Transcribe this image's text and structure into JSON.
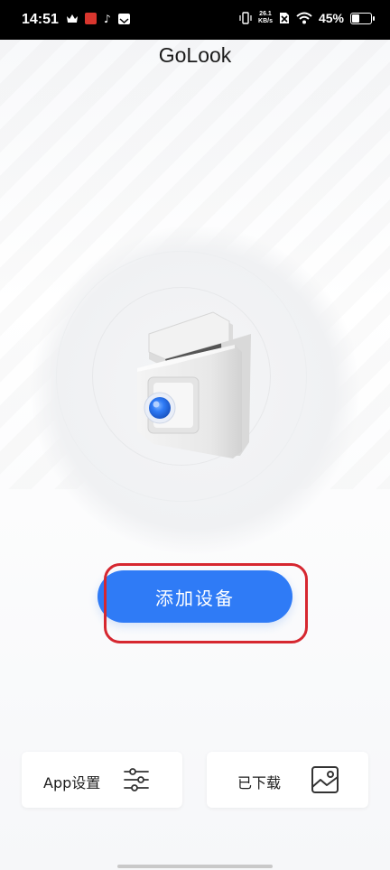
{
  "status_bar": {
    "time": "14:51",
    "net_speed_value": "26.1",
    "net_speed_unit": "KB/s",
    "battery_text": "45%",
    "battery_level": 0.45
  },
  "app": {
    "title": "GoLook"
  },
  "hero": {
    "image_name": "dashcam-device-illustration"
  },
  "actions": {
    "add_device_label": "添加设备"
  },
  "cards": {
    "app_settings_label": "App设置",
    "app_settings_icon": "sliders-icon",
    "downloaded_label": "已下载",
    "downloaded_icon": "image-icon"
  },
  "colors": {
    "accent": "#2f7bf6",
    "highlight": "#d62730"
  }
}
